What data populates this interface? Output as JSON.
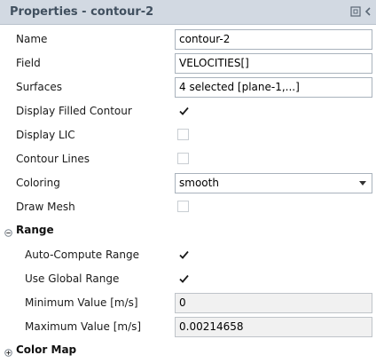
{
  "title": "Properties - contour-2",
  "icons": {
    "undock": "undock-icon",
    "collapse": "chevron-left-icon",
    "section_collapse": "minus-circle-icon",
    "section_expand": "plus-circle-icon",
    "checkmark": "checkmark-icon",
    "dropdown": "chevron-down-icon"
  },
  "properties": {
    "name": {
      "label": "Name",
      "value": "contour-2"
    },
    "field": {
      "label": "Field",
      "value": "VELOCITIES[]"
    },
    "surfaces": {
      "label": "Surfaces",
      "value": "4 selected [plane-1,...]"
    },
    "display_filled_contour": {
      "label": "Display Filled Contour",
      "checked": true
    },
    "display_lic": {
      "label": "Display LIC",
      "checked": false
    },
    "contour_lines": {
      "label": "Contour Lines",
      "checked": false
    },
    "coloring": {
      "label": "Coloring",
      "value": "smooth"
    },
    "draw_mesh": {
      "label": "Draw Mesh",
      "checked": false
    }
  },
  "range": {
    "header": "Range",
    "expanded": true,
    "auto_compute": {
      "label": "Auto-Compute Range",
      "checked": true
    },
    "use_global": {
      "label": "Use Global Range",
      "checked": true
    },
    "minimum": {
      "label": "Minimum Value [m/s]",
      "value": "0"
    },
    "maximum": {
      "label": "Maximum Value [m/s]",
      "value": "0.00214658"
    }
  },
  "color_map": {
    "header": "Color Map",
    "expanded": false
  }
}
